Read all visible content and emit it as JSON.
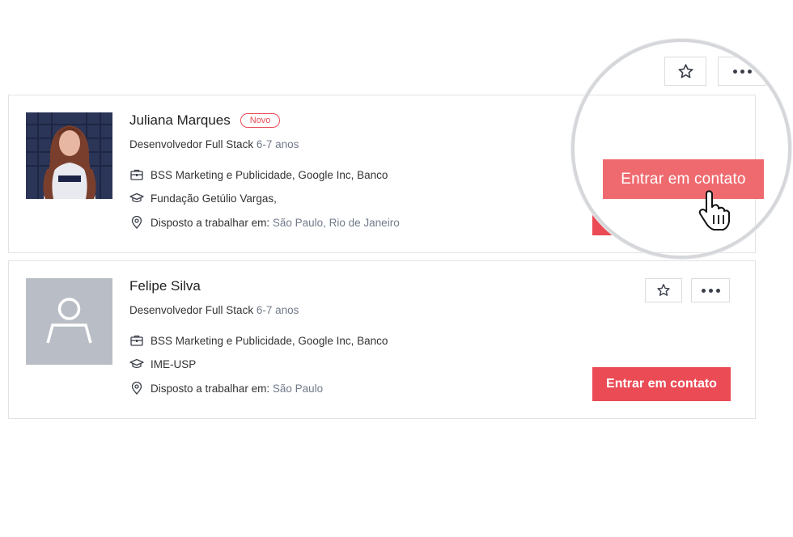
{
  "candidates": [
    {
      "name": "Juliana Marques",
      "badge": "Novo",
      "role": "Desenvolvedor Full Stack",
      "experience": "6-7 anos",
      "companies": "BSS Marketing e Publicidade, Google Inc, Banco",
      "education": "Fundação Getúlio Vargas,",
      "location_label": "Disposto a trabalhar em:",
      "locations": "São Paulo, Rio de Janeiro",
      "contact_label": "Entrar em contato",
      "avatar": "photo"
    },
    {
      "name": "Felipe Silva",
      "role": "Desenvolvedor Full Stack",
      "experience": "6-7 anos",
      "companies": "BSS Marketing e Publicidade, Google Inc, Banco",
      "education": "IME-USP",
      "location_label": "Disposto a trabalhar em:",
      "locations": "São Paulo",
      "contact_label": "Entrar em contato",
      "avatar": "placeholder-user-icon"
    }
  ],
  "icons": {
    "briefcase": "briefcase-icon",
    "education": "graduation-cap-icon",
    "location": "map-pin-icon",
    "favorite": "star-outline-icon",
    "more": "more-horizontal-icon",
    "cursor": "hand-pointer-icon"
  },
  "colors": {
    "accent": "#ea4b55",
    "accent_light": "#ef6a6f",
    "muted_text": "#717a8a",
    "placeholder_bg": "#b9bec6"
  }
}
